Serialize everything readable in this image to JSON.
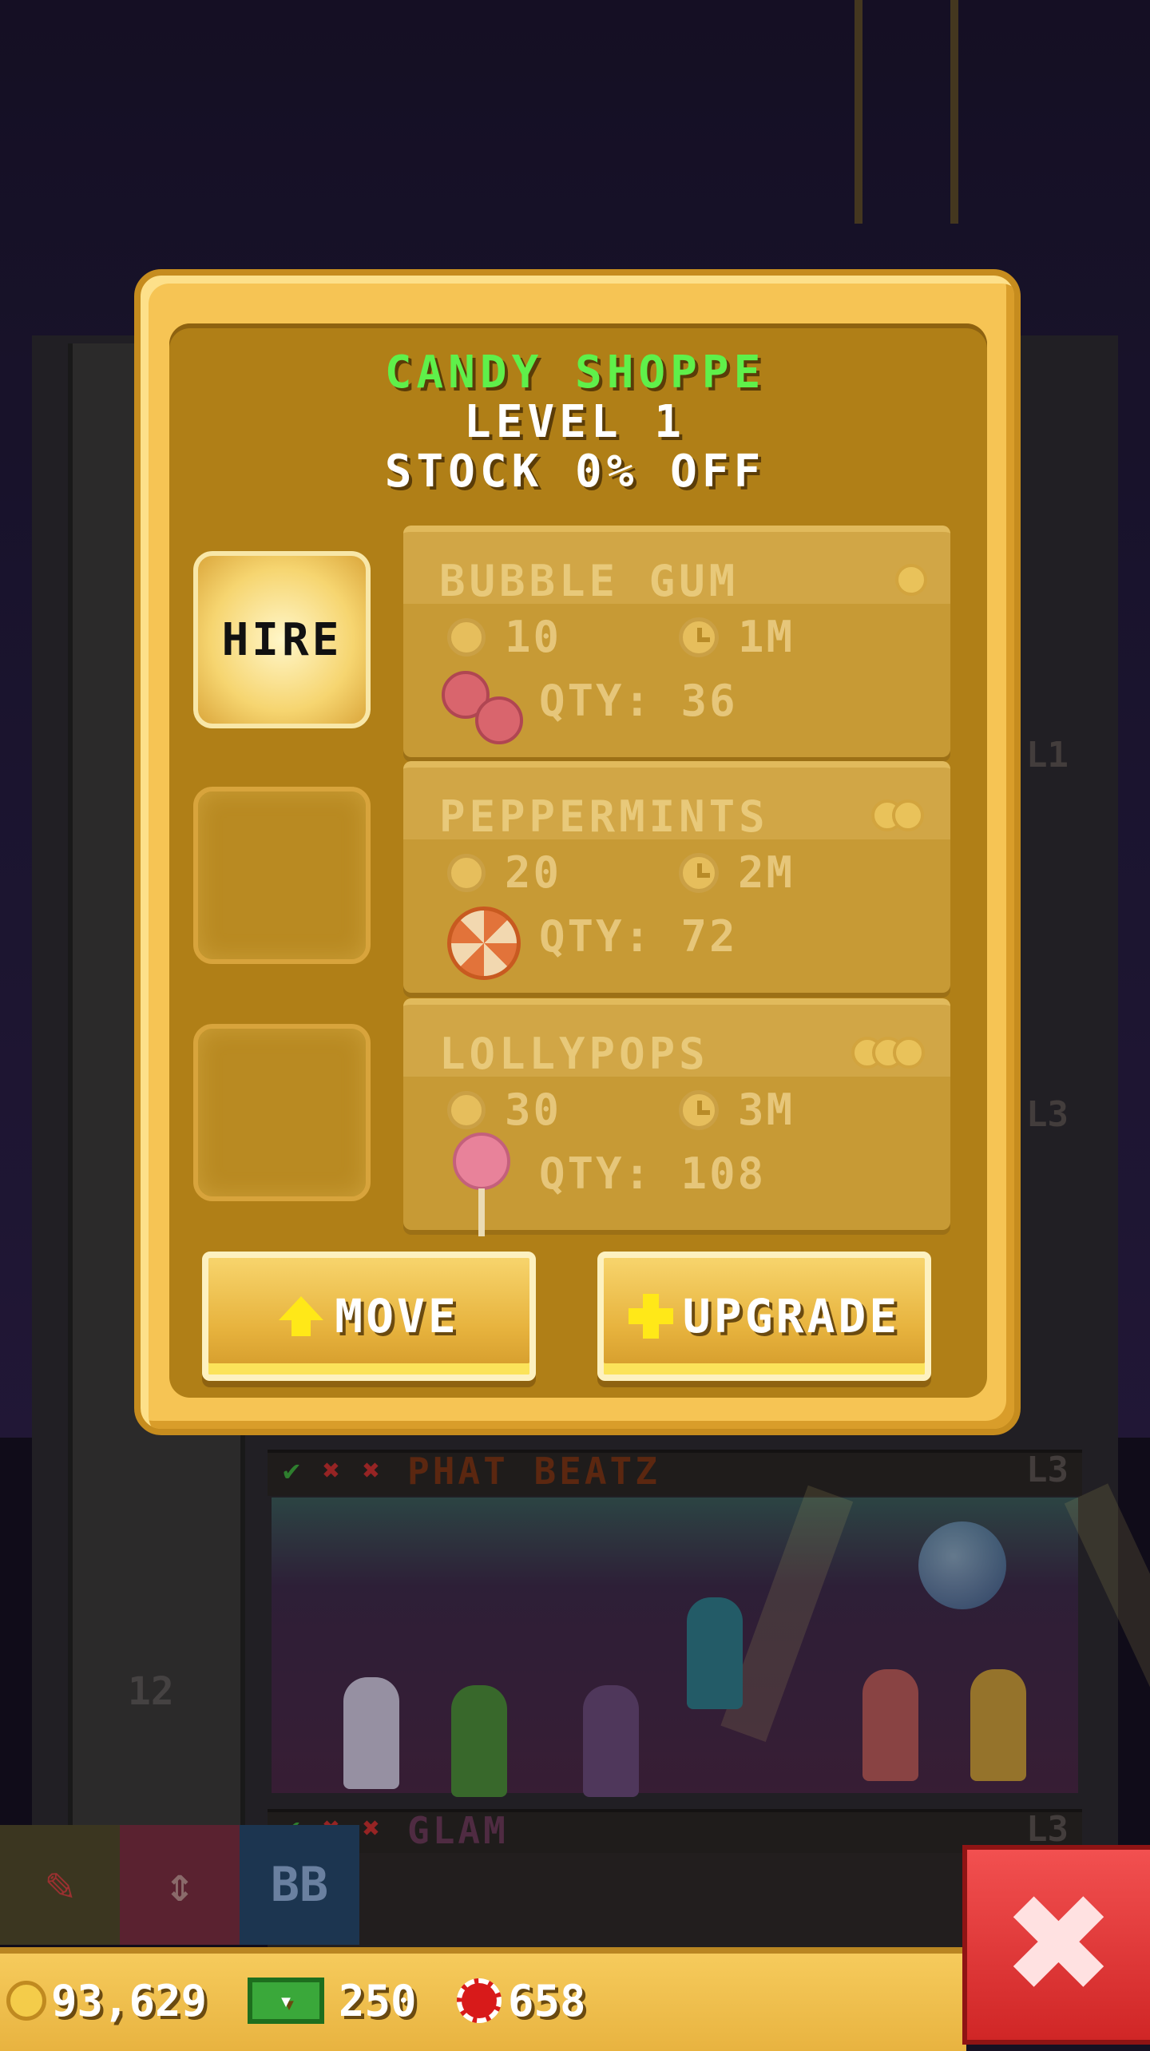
{
  "dialog": {
    "title": "CANDY SHOPPE",
    "level": "LEVEL 1",
    "stock": "STOCK 0% OFF",
    "hire_label": "HIRE",
    "products": [
      {
        "name": "BUBBLE GUM",
        "cost": "10",
        "time": "1M",
        "qty": "QTY: 36",
        "tier": 1,
        "icon": "bubble-gum-icon"
      },
      {
        "name": "PEPPERMINTS",
        "cost": "20",
        "time": "2M",
        "qty": "QTY: 72",
        "tier": 2,
        "icon": "peppermint-icon"
      },
      {
        "name": "LOLLYPOPS",
        "cost": "30",
        "time": "3M",
        "qty": "QTY: 108",
        "tier": 3,
        "icon": "lollypop-icon"
      }
    ],
    "move_label": "MOVE",
    "upgrade_label": "UPGRADE"
  },
  "background": {
    "floors": [
      {
        "name": "PHAT BEATZ",
        "level": "L3"
      },
      {
        "name": "GLAM",
        "level": "L3"
      }
    ],
    "side_levels": [
      "L1",
      "L3"
    ],
    "elevator_floor": "12"
  },
  "toolbar": {
    "bb_label": "BB"
  },
  "status": {
    "coins": "93,629",
    "bux": "250",
    "chips": "658"
  },
  "colors": {
    "shop_title": "#5ff04a",
    "dialog_gold": "#f6c454",
    "close_red": "#e23a3a"
  }
}
